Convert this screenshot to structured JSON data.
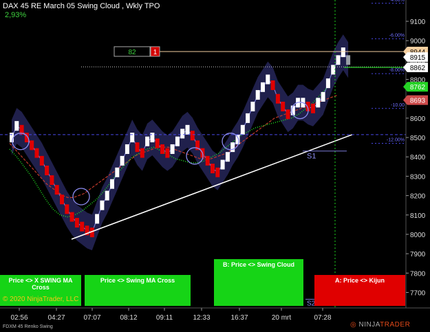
{
  "header": {
    "title": "DAX 45 RE March 05 Swing Cloud , Wkly TPO",
    "change": "2,93%"
  },
  "copyright": "© 2020 NinjaTrader, LLC",
  "instrument_label": "FDXM 45 Renko Swing",
  "brand": {
    "prefix": "NINJA",
    "suffix": "TRADER"
  },
  "panels": {
    "x_swing": "Price <> X SWING MA Cross",
    "swing_ma": "Price <> Swing MA Cross",
    "swing_cloud": "B: Price <> Swing Cloud",
    "kijun": "A: Price <> Kijun"
  },
  "tpo_box": {
    "value": "82",
    "count": "1"
  },
  "s1_label": "S1",
  "s2_label": "S2",
  "price_axis": {
    "ticks": [
      "9100",
      "9000",
      "8900",
      "8800",
      "8700",
      "8600",
      "8500",
      "8400",
      "8300",
      "8200",
      "8100",
      "8000",
      "7900",
      "7800",
      "7700"
    ],
    "markers": [
      {
        "label": "8944",
        "price": 8944,
        "bg": "#f5cfa0",
        "fg": "#000"
      },
      {
        "label": "8915",
        "price": 8915,
        "bg": "#ffffff",
        "fg": "#000"
      },
      {
        "label": "8862",
        "price": 8862,
        "bg": "#ffffff",
        "fg": "#000"
      },
      {
        "label": "8762",
        "price": 8762,
        "bg": "#25d425",
        "fg": "#fff"
      },
      {
        "label": "8693",
        "price": 8693,
        "bg": "#cd4b4b",
        "fg": "#fff"
      }
    ],
    "pct_levels": [
      {
        "label": "-4.00%",
        "price": 9193
      },
      {
        "label": "-6.00%",
        "price": 9010
      },
      {
        "label": "-8.00%",
        "price": 8830
      },
      {
        "label": "-10.00",
        "price": 8650
      },
      {
        "label": "-12.00%",
        "price": 8470
      }
    ]
  },
  "time_axis": [
    "02:56",
    "04:27",
    "07:07",
    "08:12",
    "09:11",
    "12:33",
    "16:37",
    "20 mrt",
    "07:28"
  ],
  "chart_data": {
    "type": "line",
    "y_range": [
      7620,
      9210
    ],
    "series": [
      {
        "values": [
          8500,
          8560,
          8540,
          8500,
          8460,
          8420,
          8380,
          8330,
          8280,
          8230,
          8180,
          8130,
          8090,
          8060,
          8040,
          8020,
          8010,
          8080,
          8150,
          8200,
          8260,
          8320,
          8380,
          8440,
          8500,
          8450,
          8420,
          8480,
          8500,
          8470,
          8440,
          8420,
          8440,
          8480,
          8520,
          8540,
          8510,
          8460,
          8420,
          8380,
          8340,
          8320,
          8360,
          8400,
          8450,
          8490,
          8540,
          8600,
          8660,
          8720,
          8760,
          8800,
          8770,
          8700,
          8660,
          8620,
          8640,
          8680,
          8680,
          8660,
          8650,
          8680,
          8710,
          8780,
          8850,
          8900,
          8940,
          8900
        ]
      },
      {
        "values": [
          8470,
          8440,
          8410,
          8380,
          8350,
          8320,
          8290,
          8260,
          8240,
          8220,
          8200,
          8190,
          8190,
          8200,
          8210,
          8230,
          8250,
          8270,
          8290,
          8310,
          8330,
          8350,
          8370,
          8390,
          8410,
          8420,
          8430,
          8440,
          8450,
          8450,
          8450,
          8440,
          8430,
          8420,
          8410,
          8400,
          8390,
          8390,
          8390,
          8400,
          8410,
          8420,
          8440,
          8460,
          8480,
          8500,
          8520,
          8540,
          8560,
          8580,
          8600,
          8610,
          8620,
          8630,
          8640,
          8650,
          8660,
          8670,
          8680,
          8690,
          8700,
          8710,
          8720
        ]
      },
      {
        "values": [
          8440,
          8400,
          8350,
          8300,
          8240,
          8180,
          8130,
          8100,
          8090,
          8100,
          8120,
          8150,
          8180,
          8220,
          8270,
          8320,
          8360,
          8400,
          8420,
          8440,
          8450,
          8430,
          8410,
          8390,
          8380,
          8370,
          8370,
          8380,
          8400,
          8420,
          8450,
          8480,
          8510,
          8530,
          8550,
          8560,
          8570,
          8580,
          8590,
          8600,
          8620,
          8650,
          8680,
          8720,
          8760
        ]
      }
    ]
  }
}
